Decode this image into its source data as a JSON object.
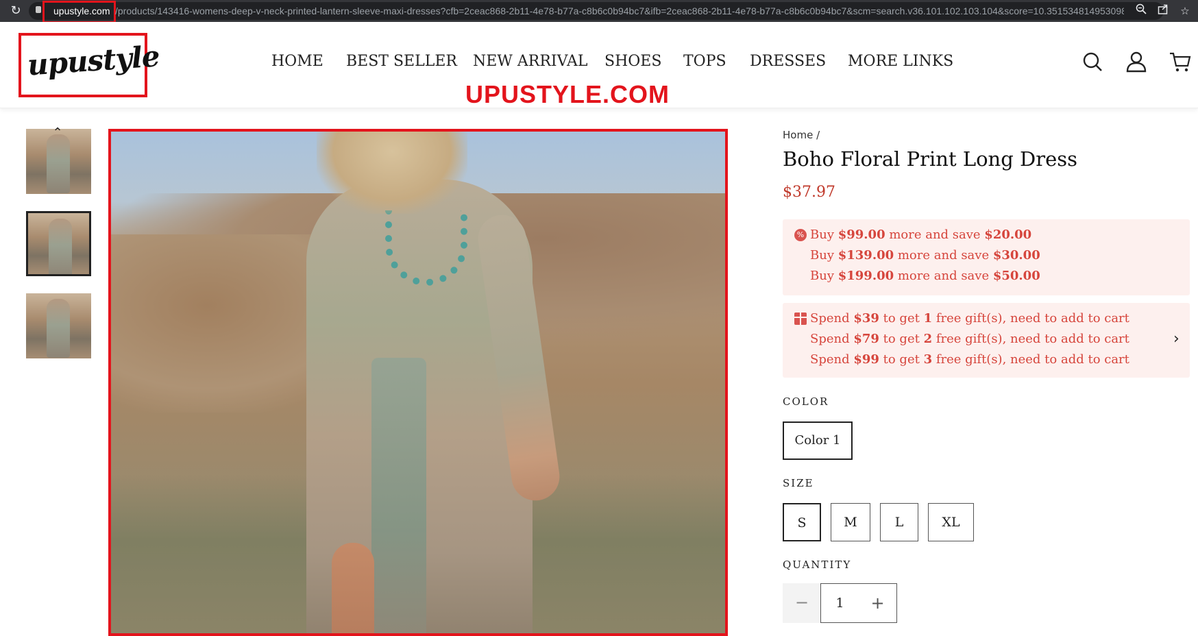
{
  "browser": {
    "url_host": "upustyle.com",
    "url_path": "/products/143416-womens-deep-v-neck-printed-lantern-sleeve-maxi-dresses?cfb=2ceac868-2b11-4e78-b77a-c8b6c0b94bc7&ifb=2ceac868-2b11-4e78-b77a-c8b6c0b94bc7&scm=search.v36.101.102.103.104&score=10.351534814953098...",
    "icons": [
      "reload-icon",
      "zoom-icon",
      "share-icon",
      "bookmark-star-icon"
    ]
  },
  "header": {
    "logo_text": "upustyle",
    "watermark": "UPUSTYLE.COM",
    "nav": [
      "HOME",
      "BEST SELLER",
      "NEW ARRIVAL",
      "SHOES",
      "TOPS",
      "DRESSES",
      "MORE LINKS"
    ],
    "icons": [
      "search-icon",
      "account-icon",
      "cart-icon"
    ]
  },
  "gallery": {
    "thumbnail_count": 3,
    "selected_thumbnail": 2
  },
  "product": {
    "breadcrumb": "Home /",
    "title": "Boho Floral Print Long Dress",
    "price": "$37.97",
    "discounts": [
      {
        "pre": "Buy ",
        "amount": "$99.00",
        "mid": " more and save ",
        "save": "$20.00"
      },
      {
        "pre": "Buy ",
        "amount": "$139.00",
        "mid": " more and save ",
        "save": "$30.00"
      },
      {
        "pre": "Buy ",
        "amount": "$199.00",
        "mid": " more and save ",
        "save": "$50.00"
      }
    ],
    "gifts": [
      {
        "pre": "Spend ",
        "amount": "$39",
        "mid": " to get ",
        "count": "1",
        "post": " free gift(s), need to add to cart"
      },
      {
        "pre": "Spend ",
        "amount": "$79",
        "mid": " to get ",
        "count": "2",
        "post": " free gift(s), need to add to cart"
      },
      {
        "pre": "Spend ",
        "amount": "$99",
        "mid": " to get ",
        "count": "3",
        "post": " free gift(s), need to add to cart"
      }
    ],
    "color_label": "COLOR",
    "color_option": "Color 1",
    "size_label": "SIZE",
    "sizes": [
      "S",
      "M",
      "L",
      "XL"
    ],
    "selected_size": "S",
    "quantity_label": "QUANTITY",
    "quantity": "1",
    "qty_minus": "−",
    "qty_plus": "+"
  },
  "colors": {
    "accent_red": "#e3141c",
    "price_red": "#c0392b",
    "promo_bg": "#fdf0ee",
    "promo_text": "#d6453c"
  }
}
